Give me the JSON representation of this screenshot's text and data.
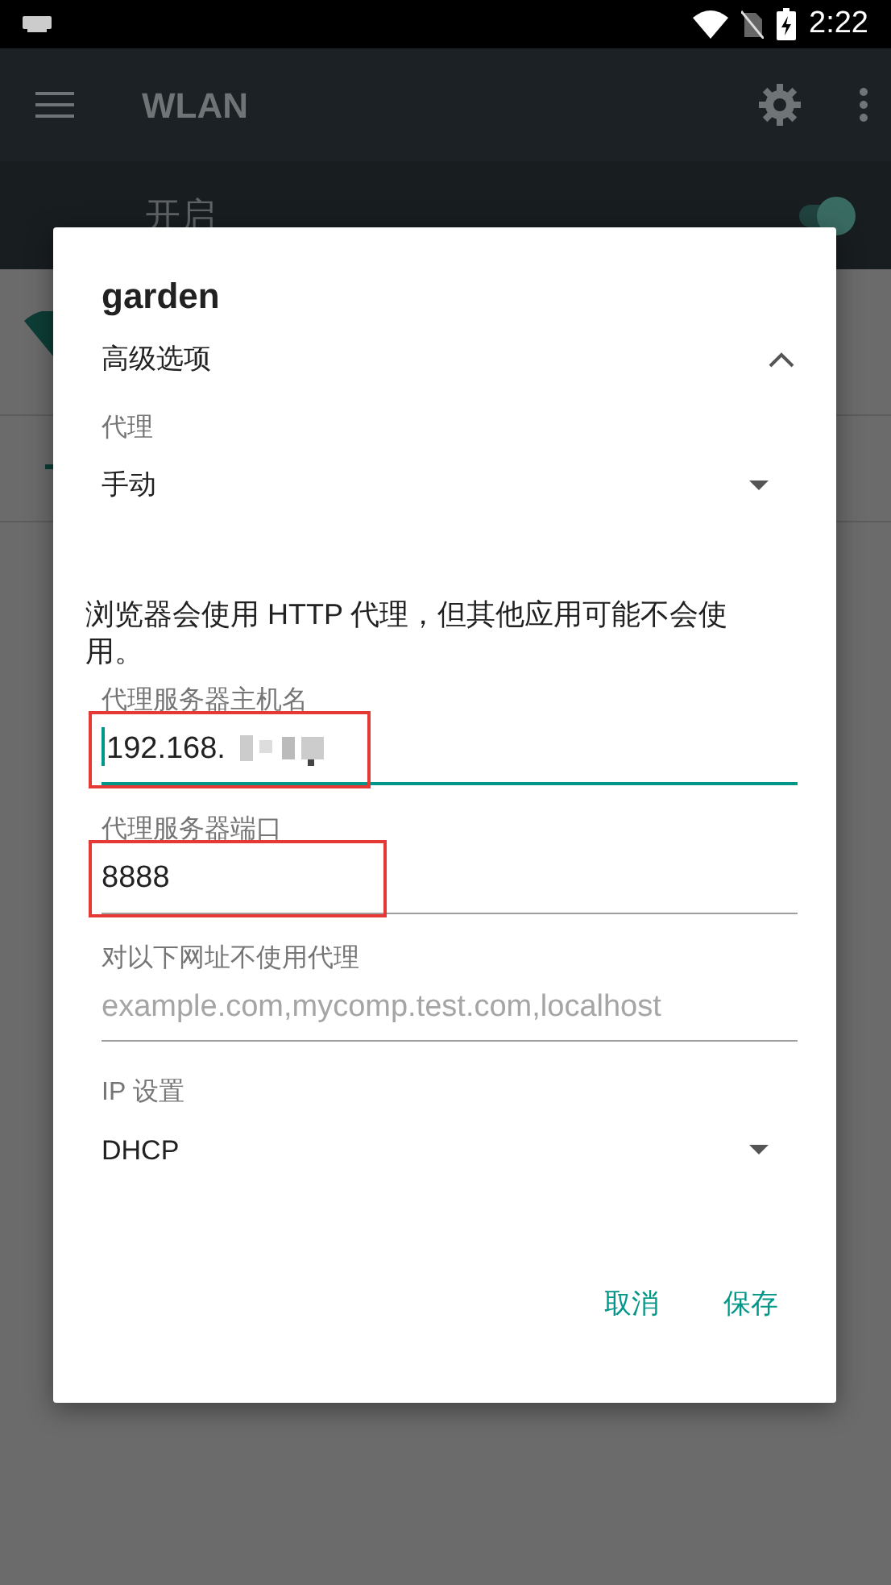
{
  "status_bar": {
    "time": "2:22"
  },
  "app_bar": {
    "title": "WLAN"
  },
  "wifi_switch": {
    "label": "开启",
    "on": true
  },
  "dialog": {
    "title": "garden",
    "advanced": {
      "label": "高级选项",
      "expanded": true
    },
    "proxy": {
      "label": "代理",
      "value": "手动"
    },
    "note": "浏览器会使用 HTTP 代理，但其他应用可能不会使用。",
    "fields": [
      {
        "label": "代理服务器主机名",
        "value": "192.168.",
        "focused": true,
        "highlighted": true
      },
      {
        "label": "代理服务器端口",
        "value": "8888",
        "focused": false,
        "highlighted": true
      },
      {
        "label": "对以下网址不使用代理",
        "placeholder": "example.com,mycomp.test.com,localhost",
        "focused": false,
        "highlighted": false
      }
    ],
    "ip": {
      "label": "IP 设置",
      "value": "DHCP"
    },
    "buttons": [
      "取消",
      "保存"
    ]
  }
}
